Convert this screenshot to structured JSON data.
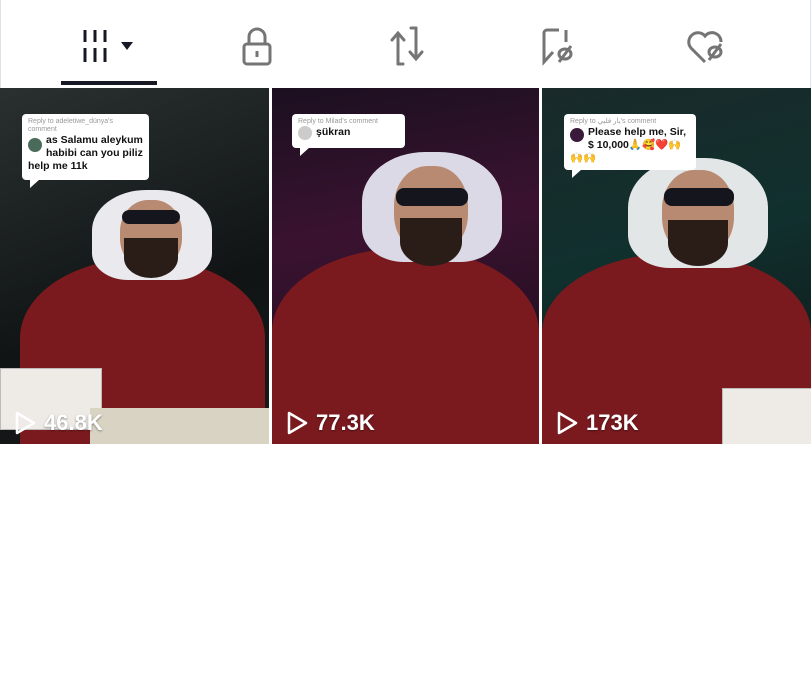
{
  "tabs": [
    {
      "icon": "videos-grid-icon",
      "active": true,
      "has_dropdown": true
    },
    {
      "icon": "lock-icon",
      "active": false
    },
    {
      "icon": "repost-icon",
      "active": false
    },
    {
      "icon": "favorites-hidden-icon",
      "active": false
    },
    {
      "icon": "liked-hidden-icon",
      "active": false
    }
  ],
  "colors": {
    "active": "#161823",
    "inactive": "#757575",
    "robe": "#7a1a1f"
  },
  "videos": [
    {
      "reply_to": "Reply to adeletiwe_dünya's comment",
      "comment": "as Salamu aleykum habibi can you piliz help me 11k",
      "views": "46.8K"
    },
    {
      "reply_to": "Reply to Milad's comment",
      "comment": "şükran",
      "views": "77.3K"
    },
    {
      "reply_to": "Reply to يار قلبي's comment",
      "comment": "Please help me, Sir, $ 10,000🙏🥰❤️🙌🙌🙌",
      "views": "173K"
    }
  ]
}
